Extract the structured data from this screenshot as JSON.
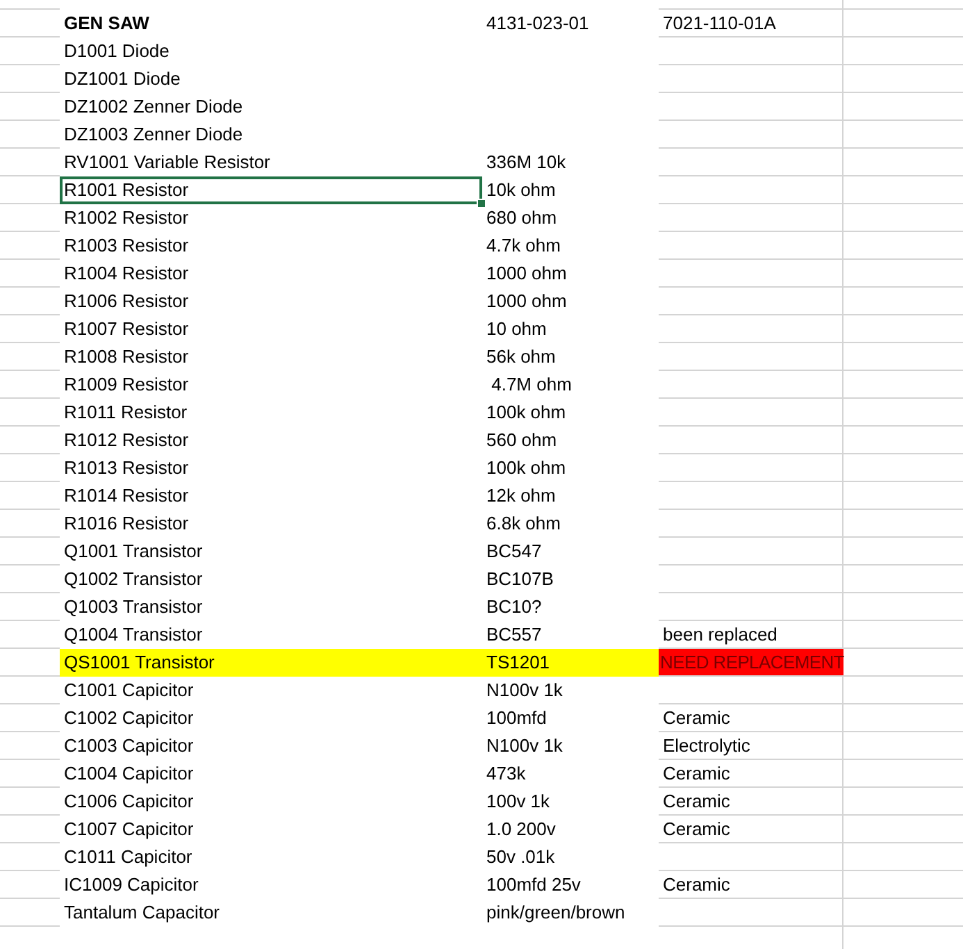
{
  "sheet": {
    "rows": [
      {
        "kind": "header",
        "item": "GEN SAW",
        "value": "4131-023-01",
        "note": "7021-110-01A",
        "selected": false,
        "highlight": false
      },
      {
        "kind": "part",
        "item": "D1001 Diode",
        "selected": false,
        "highlight": false
      },
      {
        "kind": "part",
        "item": "DZ1001 Diode",
        "selected": false,
        "highlight": false
      },
      {
        "kind": "part",
        "item": "DZ1002 Zenner Diode",
        "selected": false,
        "highlight": false
      },
      {
        "kind": "part",
        "item": "DZ1003 Zenner Diode",
        "selected": false,
        "highlight": false
      },
      {
        "kind": "part",
        "item": "RV1001 Variable Resistor",
        "value": "336M 10k",
        "selected": false,
        "highlight": false
      },
      {
        "kind": "part",
        "item": "R1001 Resistor",
        "value": "10k ohm",
        "selected": true,
        "highlight": false
      },
      {
        "kind": "part",
        "item": "R1002 Resistor",
        "value": "680 ohm",
        "selected": false,
        "highlight": false
      },
      {
        "kind": "part",
        "item": "R1003 Resistor",
        "value": "4.7k ohm",
        "selected": false,
        "highlight": false
      },
      {
        "kind": "part",
        "item": "R1004 Resistor",
        "value": "1000 ohm",
        "selected": false,
        "highlight": false
      },
      {
        "kind": "part",
        "item": "R1006 Resistor",
        "value": "1000 ohm",
        "selected": false,
        "highlight": false
      },
      {
        "kind": "part",
        "item": "R1007 Resistor",
        "value": "10 ohm",
        "selected": false,
        "highlight": false
      },
      {
        "kind": "part",
        "item": "R1008 Resistor",
        "value": "56k ohm",
        "selected": false,
        "highlight": false
      },
      {
        "kind": "part",
        "item": "R1009 Resistor",
        "value": " 4.7M ohm",
        "selected": false,
        "highlight": false
      },
      {
        "kind": "part",
        "item": "R1011 Resistor",
        "value": "100k ohm",
        "selected": false,
        "highlight": false
      },
      {
        "kind": "part",
        "item": "R1012 Resistor",
        "value": "560 ohm",
        "selected": false,
        "highlight": false
      },
      {
        "kind": "part",
        "item": "R1013 Resistor",
        "value": "100k ohm",
        "selected": false,
        "highlight": false
      },
      {
        "kind": "part",
        "item": "R1014 Resistor",
        "value": "12k ohm",
        "selected": false,
        "highlight": false
      },
      {
        "kind": "part",
        "item": "R1016 Resistor",
        "value": "6.8k ohm",
        "selected": false,
        "highlight": false
      },
      {
        "kind": "part",
        "item": "Q1001 Transistor",
        "value": "BC547",
        "selected": false,
        "highlight": false
      },
      {
        "kind": "part",
        "item": "Q1002 Transistor",
        "value": "BC107B",
        "selected": false,
        "highlight": false
      },
      {
        "kind": "part",
        "item": "Q1003 Transistor",
        "value": "BC10?",
        "selected": false,
        "highlight": false
      },
      {
        "kind": "part",
        "item": "Q1004 Transistor",
        "value": "BC557",
        "note": "been replaced",
        "selected": false,
        "highlight": false
      },
      {
        "kind": "part",
        "item": "QS1001 Transistor",
        "value": "TS1201",
        "note": "NEED REPLACEMENT",
        "alert": true,
        "selected": false,
        "highlight": true
      },
      {
        "kind": "part",
        "item": "C1001 Capicitor",
        "value": "N100v 1k",
        "selected": false,
        "highlight": false
      },
      {
        "kind": "part",
        "item": "C1002 Capicitor",
        "value": "100mfd",
        "note": "Ceramic",
        "selected": false,
        "highlight": false
      },
      {
        "kind": "part",
        "item": "C1003 Capicitor",
        "value": "N100v 1k",
        "note": "Electrolytic",
        "selected": false,
        "highlight": false
      },
      {
        "kind": "part",
        "item": "C1004 Capicitor",
        "value": "473k",
        "note": "Ceramic",
        "selected": false,
        "highlight": false
      },
      {
        "kind": "part",
        "item": "C1006 Capicitor",
        "value": "100v 1k",
        "note": "Ceramic",
        "selected": false,
        "highlight": false
      },
      {
        "kind": "part",
        "item": "C1007 Capicitor",
        "value": "1.0 200v",
        "note": "Ceramic",
        "selected": false,
        "highlight": false
      },
      {
        "kind": "part",
        "item": "C1011 Capicitor",
        "value": "50v .01k",
        "selected": false,
        "highlight": false
      },
      {
        "kind": "part",
        "item": "IC1009 Capicitor",
        "value": "100mfd 25v",
        "note": "Ceramic",
        "selected": false,
        "highlight": false
      },
      {
        "kind": "part",
        "item": "Tantalum Capacitor",
        "value": "pink/green/brown",
        "selected": false,
        "highlight": false
      }
    ]
  }
}
